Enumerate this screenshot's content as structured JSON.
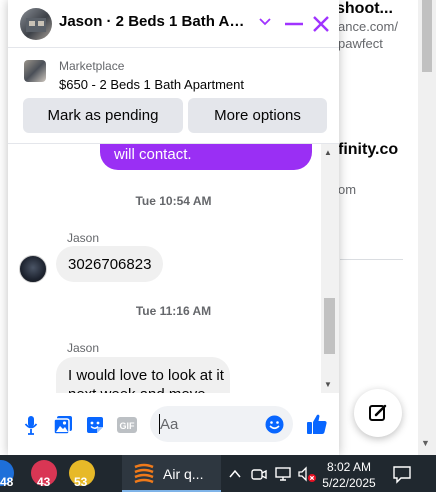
{
  "background": {
    "snippets": [
      "shoot...",
      "ance.com/",
      "pawfect",
      "finity.co",
      "om"
    ]
  },
  "chat": {
    "title": "Jason · 2 Beds 1 Bath Apar...",
    "listing": {
      "category": "Marketplace",
      "title": "$650 - 2 Beds 1 Bath Apartment"
    },
    "actions": {
      "pending_label": "Mark as pending",
      "options_label": "More options"
    },
    "messages": {
      "outgoing_partial": "will contact.",
      "timestamp_1": "Tue 10:54 AM",
      "sender_1": "Jason",
      "phone_message": "3026706823",
      "timestamp_2": "Tue 11:16 AM",
      "sender_2": "Jason",
      "long_message": "I would love to look at it next week and move"
    },
    "composer": {
      "placeholder": "Aa"
    }
  },
  "taskbar": {
    "badges": [
      "48",
      "43",
      "53"
    ],
    "app_label": "Air q...",
    "time": "8:02 AM",
    "date": "5/22/2025"
  },
  "colors": {
    "accent": "#a033ff",
    "messenger_blue": "#0866ff",
    "taskbar": "#20282f"
  }
}
